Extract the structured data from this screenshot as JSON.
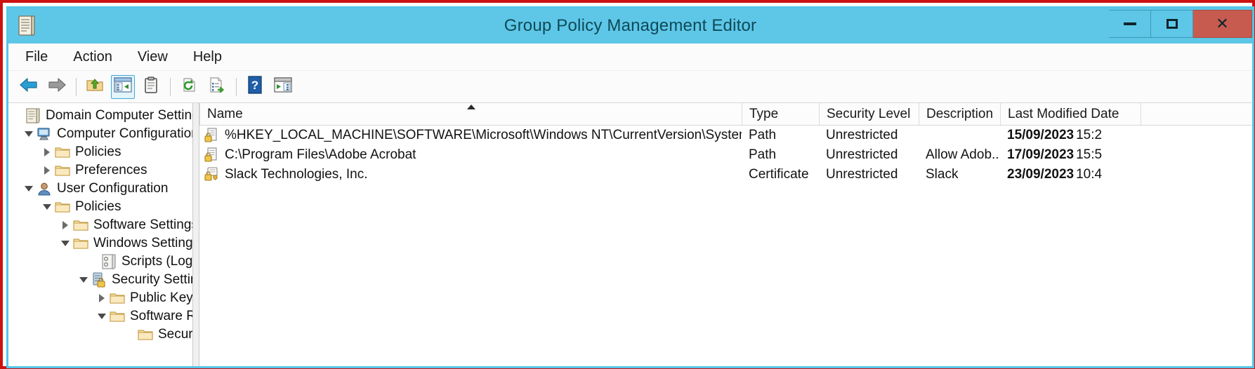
{
  "window": {
    "title": "Group Policy Management Editor",
    "icon": "policy-document-icon",
    "controls": {
      "minimize_label": "Minimize",
      "maximize_label": "Maximize",
      "close_label": "Close",
      "close_glyph": "✕"
    },
    "colors": {
      "title_bar": "#5ec7e8",
      "title_text": "#0e4a56",
      "close_button": "#c75b50",
      "annotation_border": "#cc1111",
      "window_border": "#54c5e8",
      "toolbar_active": "#3fa9d4"
    }
  },
  "menu": {
    "items": [
      {
        "label": "File",
        "name": "menu-file"
      },
      {
        "label": "Action",
        "name": "menu-action"
      },
      {
        "label": "View",
        "name": "menu-view"
      },
      {
        "label": "Help",
        "name": "menu-help"
      }
    ]
  },
  "toolbar": {
    "buttons": [
      {
        "icon": "back-arrow-icon",
        "label": "Back",
        "active": false
      },
      {
        "icon": "forward-arrow-icon",
        "label": "Forward",
        "active": false
      },
      {
        "icon": "up-one-level-icon",
        "label": "Up One Level",
        "active": false
      },
      {
        "icon": "show-hide-console-tree-icon",
        "label": "Show/Hide Console Tree",
        "active": true
      },
      {
        "icon": "properties-clipboard-icon",
        "label": "Properties",
        "active": false
      },
      {
        "icon": "refresh-icon",
        "label": "Refresh",
        "active": false
      },
      {
        "icon": "export-list-icon",
        "label": "Export List",
        "active": false
      },
      {
        "icon": "help-icon",
        "label": "Help",
        "active": false
      },
      {
        "icon": "show-action-pane-icon",
        "label": "Show/Hide Action Pane",
        "active": false
      }
    ]
  },
  "tree": {
    "items": [
      {
        "label": "Domain Computer Settings",
        "indent": 0,
        "twisty": "none",
        "icon": "policy-document-icon"
      },
      {
        "label": "Computer Configuration",
        "indent": 1,
        "twisty": "expanded",
        "icon": "computer-icon"
      },
      {
        "label": "Policies",
        "indent": 2,
        "twisty": "collapsed",
        "icon": "folder-icon"
      },
      {
        "label": "Preferences",
        "indent": 2,
        "twisty": "collapsed",
        "icon": "folder-icon"
      },
      {
        "label": "User Configuration",
        "indent": 1,
        "twisty": "expanded",
        "icon": "user-icon"
      },
      {
        "label": "Policies",
        "indent": 2,
        "twisty": "expanded",
        "icon": "folder-icon"
      },
      {
        "label": "Software Settings",
        "indent": 3,
        "twisty": "collapsed",
        "icon": "folder-icon"
      },
      {
        "label": "Windows Settings",
        "indent": 3,
        "twisty": "expanded",
        "icon": "folder-icon"
      },
      {
        "label": "Scripts (Logon/Logoff)",
        "indent": 4,
        "twisty": "none",
        "icon": "scripts-icon"
      },
      {
        "label": "Security Settings",
        "indent": 4,
        "twisty": "expanded",
        "icon": "security-settings-icon"
      },
      {
        "label": "Public Key Policies",
        "indent": 5,
        "twisty": "collapsed",
        "icon": "folder-icon"
      },
      {
        "label": "Software Restriction Policies",
        "indent": 5,
        "twisty": "expanded",
        "icon": "folder-icon"
      },
      {
        "label": "Security Levels",
        "indent": 6,
        "twisty": "none",
        "icon": "folder-icon"
      }
    ]
  },
  "list_view": {
    "columns": [
      {
        "label": "Name",
        "name": "column-name",
        "sorted": "asc"
      },
      {
        "label": "Type",
        "name": "column-type",
        "sorted": "none"
      },
      {
        "label": "Security Level",
        "name": "column-security-level",
        "sorted": "none"
      },
      {
        "label": "Description",
        "name": "column-description",
        "sorted": "none"
      },
      {
        "label": "Last Modified Date",
        "name": "column-last-modified-date",
        "sorted": "none"
      }
    ],
    "rows": [
      {
        "icon": "path-rule-icon",
        "name": "%HKEY_LOCAL_MACHINE\\SOFTWARE\\Microsoft\\Windows NT\\CurrentVersion\\SystemRoot%",
        "type": "Path",
        "security_level": "Unrestricted",
        "description": "",
        "date": "15/09/2023",
        "time": "15:2"
      },
      {
        "icon": "path-rule-icon",
        "name": "C:\\Program Files\\Adobe Acrobat",
        "type": "Path",
        "security_level": "Unrestricted",
        "description": "Allow Adob...",
        "date": "17/09/2023",
        "time": "15:5"
      },
      {
        "icon": "certificate-rule-icon",
        "name": "Slack Technologies, Inc.",
        "type": "Certificate",
        "security_level": "Unrestricted",
        "description": "Slack",
        "date": "23/09/2023",
        "time": "10:4"
      }
    ]
  }
}
